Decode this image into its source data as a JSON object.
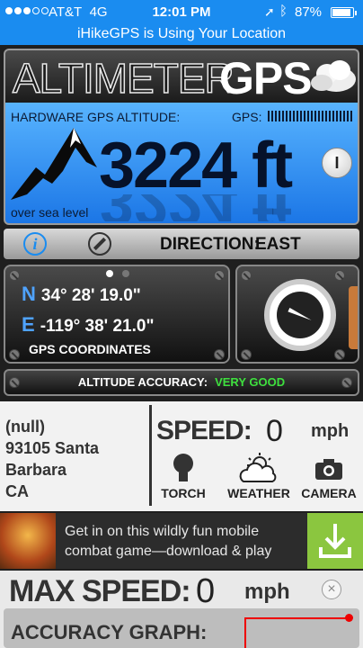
{
  "status_bar": {
    "carrier": "AT&T",
    "network": "4G",
    "time": "12:01 PM",
    "battery": "87%"
  },
  "location_banner": "iHikeGPS is Using Your Location",
  "header": {
    "title_part1": "ALTIMETER",
    "title_part2": "GPS"
  },
  "altitude": {
    "label": "HARDWARE GPS ALTITUDE:",
    "gps_label": "GPS:",
    "value": "3224 ft",
    "reference": "over sea level",
    "lock_label": "I"
  },
  "direction": {
    "label": "DIRECTION:",
    "value": "EAST",
    "info_label": "i"
  },
  "coordinates": {
    "lat_letter": "N",
    "latitude": "34° 28' 19.0\"",
    "lon_letter": "E",
    "longitude": "-119° 38' 21.0\"",
    "caption": "GPS COORDINATES"
  },
  "accuracy": {
    "label": "ALTITUDE ACCURACY:",
    "value": "VERY GOOD",
    "value_color": "#3ee03e"
  },
  "address": {
    "line1": "(null)",
    "line2": "93105 Santa",
    "line3": "Barbara",
    "line4": "CA"
  },
  "speed": {
    "label": "SPEED:",
    "value": "0",
    "unit": "mph"
  },
  "tools": [
    {
      "label": "TORCH",
      "icon": "torch-icon"
    },
    {
      "label": "WEATHER",
      "icon": "weather-icon"
    },
    {
      "label": "CAMERA",
      "icon": "camera-icon"
    }
  ],
  "ad": {
    "text": "Get in on this wildly fun mobile combat game—download & play",
    "accent": "#8bc63f"
  },
  "max_speed": {
    "label": "MAX SPEED:",
    "value": "0",
    "unit": "mph",
    "close_label": "×"
  },
  "accuracy_graph": {
    "label": "ACCURACY GRAPH:"
  }
}
